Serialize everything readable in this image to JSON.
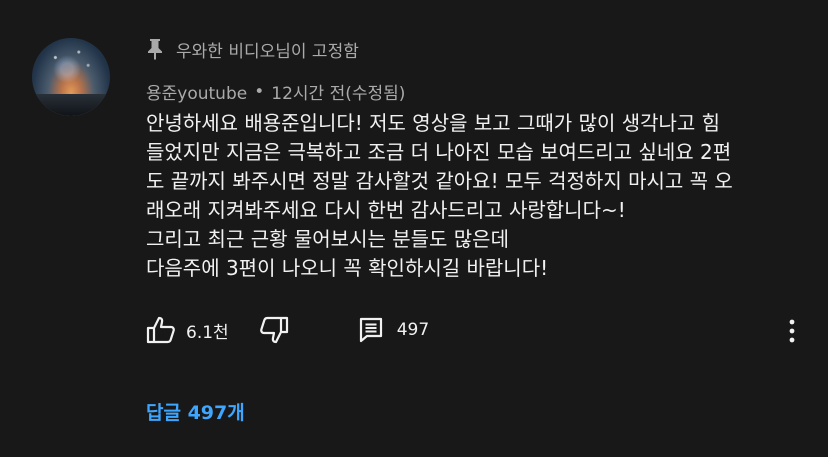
{
  "pinned": {
    "text": "우와한 비디오님이 고정함",
    "icon": "pin-icon"
  },
  "author": {
    "name": "용준youtube",
    "separator": "•",
    "time": "12시간 전(수정됨)"
  },
  "comment_lines": [
    "안녕하세요 배용준입니다! 저도 영상을 보고 그때가 많이 생각나고 힘",
    "들었지만 지금은 극복하고 조금 더 나아진 모습 보여드리고 싶네요 2편",
    "도 끝까지 봐주시면 정말 감사할것 같아요! 모두 걱정하지 마시고 꼭 오",
    "래오래 지켜봐주세요 다시 한번 감사드리고 사랑합니다~!",
    "그리고 최근 근황 물어보시는 분들도 많은데",
    "다음주에 3편이 나오니 꼭 확인하시길 바랍니다!"
  ],
  "actions": {
    "like_count": "6.1천",
    "reply_count": "497"
  },
  "replies_link": "답글 497개",
  "colors": {
    "background": "#181818",
    "text": "#f1f1f1",
    "secondary": "#aaaaaa",
    "link": "#3ea6ff"
  }
}
